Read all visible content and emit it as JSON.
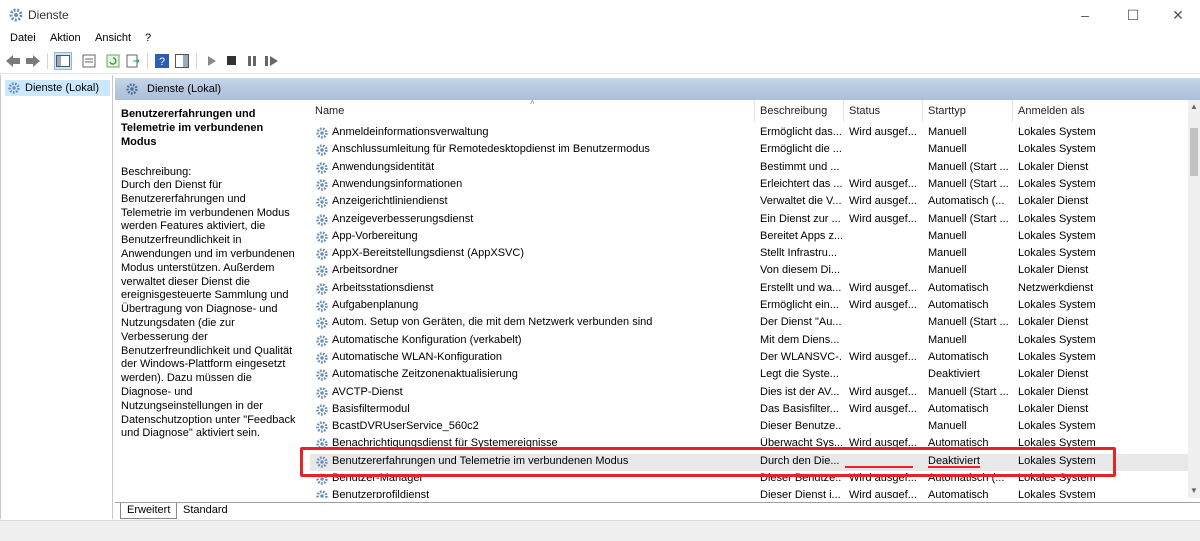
{
  "window": {
    "title": "Dienste",
    "controls": [
      "–",
      "☐",
      "✕"
    ]
  },
  "menu": [
    "Datei",
    "Aktion",
    "Ansicht",
    "?"
  ],
  "tree": {
    "root_label": "Dienste (Lokal)"
  },
  "main": {
    "header": "Dienste (Lokal)",
    "description": {
      "title": "Benutzererfahrungen und Telemetrie im verbundenen Modus",
      "label": "Beschreibung:",
      "text": "Durch den Dienst für Benutzererfahrungen und Telemetrie im verbundenen Modus werden Features aktiviert, die Benutzerfreundlichkeit in Anwendungen und im verbundenen Modus unterstützen. Außerdem verwaltet dieser Dienst die ereignisgesteuerte Sammlung und Übertragung von Diagnose- und Nutzungsdaten (die zur Verbesserung der Benutzerfreundlichkeit und Qualität der Windows-Plattform eingesetzt werden). Dazu müssen die Diagnose- und Nutzungseinstellungen in der Datenschutzoption unter \"Feedback und Diagnose\" aktiviert sein."
    },
    "columns": [
      "Name",
      "Beschreibung",
      "Status",
      "Starttyp",
      "Anmelden als"
    ],
    "rows": [
      [
        "Anmeldeinformationsverwaltung",
        "Ermöglicht das...",
        "Wird ausgef...",
        "Manuell",
        "Lokales System"
      ],
      [
        "Anschlussumleitung für Remotedesktopdienst im Benutzermodus",
        "Ermöglicht die ...",
        "",
        "Manuell",
        "Lokales System"
      ],
      [
        "Anwendungsidentität",
        "Bestimmt und ...",
        "",
        "Manuell (Start ...",
        "Lokaler Dienst"
      ],
      [
        "Anwendungsinformationen",
        "Erleichtert das ...",
        "Wird ausgef...",
        "Manuell (Start ...",
        "Lokales System"
      ],
      [
        "Anzeigerichtliniendienst",
        "Verwaltet die V...",
        "Wird ausgef...",
        "Automatisch (...",
        "Lokaler Dienst"
      ],
      [
        "Anzeigeverbesserungsdienst",
        "Ein Dienst zur ...",
        "Wird ausgef...",
        "Manuell (Start ...",
        "Lokales System"
      ],
      [
        "App-Vorbereitung",
        "Bereitet Apps z...",
        "",
        "Manuell",
        "Lokales System"
      ],
      [
        "AppX-Bereitstellungsdienst (AppXSVC)",
        "Stellt Infrastru...",
        "",
        "Manuell",
        "Lokales System"
      ],
      [
        "Arbeitsordner",
        "Von diesem Di...",
        "",
        "Manuell",
        "Lokaler Dienst"
      ],
      [
        "Arbeitsstationsdienst",
        "Erstellt und wa...",
        "Wird ausgef...",
        "Automatisch",
        "Netzwerkdienst"
      ],
      [
        "Aufgabenplanung",
        "Ermöglicht ein...",
        "Wird ausgef...",
        "Automatisch",
        "Lokales System"
      ],
      [
        "Autom. Setup von Geräten, die mit dem Netzwerk verbunden sind",
        "Der Dienst \"Au...",
        "",
        "Manuell (Start ...",
        "Lokaler Dienst"
      ],
      [
        "Automatische Konfiguration (verkabelt)",
        "Mit dem Diens...",
        "",
        "Manuell",
        "Lokales System"
      ],
      [
        "Automatische WLAN-Konfiguration",
        "Der WLANSVC-...",
        "Wird ausgef...",
        "Automatisch",
        "Lokales System"
      ],
      [
        "Automatische Zeitzonenaktualisierung",
        "Legt die Syste...",
        "",
        "Deaktiviert",
        "Lokaler Dienst"
      ],
      [
        "AVCTP-Dienst",
        "Dies ist der AV...",
        "Wird ausgef...",
        "Manuell (Start ...",
        "Lokaler Dienst"
      ],
      [
        "Basisfiltermodul",
        "Das Basisfilter...",
        "Wird ausgef...",
        "Automatisch",
        "Lokaler Dienst"
      ],
      [
        "BcastDVRUserService_560c2",
        "Dieser Benutze...",
        "",
        "Manuell",
        "Lokales System"
      ],
      [
        "Benachrichtigungsdienst für Systemereignisse",
        "Überwacht Sys...",
        "Wird ausgef...",
        "Automatisch",
        "Lokales System"
      ],
      [
        "Benutzererfahrungen und Telemetrie im verbundenen Modus",
        "Durch den Die...",
        "",
        "Deaktiviert",
        "Lokales System"
      ],
      [
        "Benutzer-Manager",
        "Dieser Benutze...",
        "Wird ausgef...",
        "Automatisch (...",
        "Lokales System"
      ],
      [
        "Benutzerprofildienst",
        "Dieser Dienst i...",
        "Wird ausgef...",
        "Automatisch",
        "Lokales System"
      ]
    ],
    "selected_row": 19
  },
  "tabs": [
    "Erweitert",
    "Standard"
  ],
  "colors": {
    "highlight": "#e3242b",
    "header_gradient": "#b8cbe2",
    "tree_selection": "#cce8ff"
  }
}
